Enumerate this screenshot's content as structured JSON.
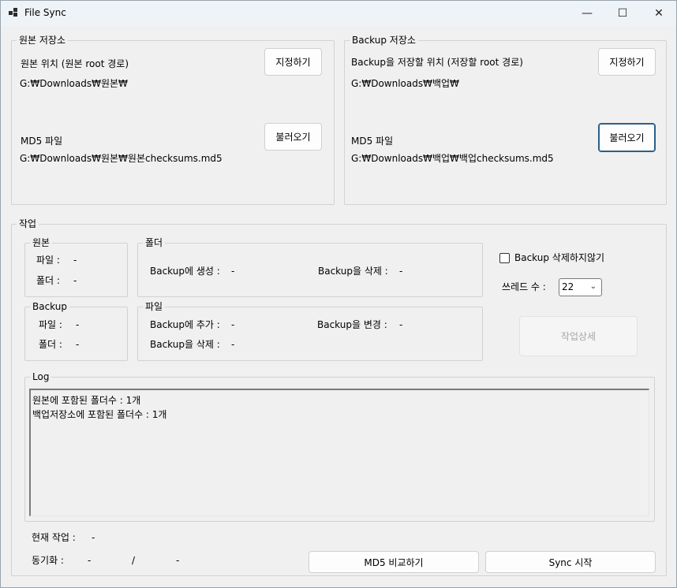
{
  "window": {
    "title": "File Sync",
    "minimize": "—",
    "maximize": "☐",
    "close": "✕"
  },
  "source": {
    "group_title": "원본 저장소",
    "location_label": "원본 위치 (원본 root 경로)",
    "location_button": "지정하기",
    "location_path": "G:₩Downloads₩원본₩",
    "md5_label": "MD5 파일",
    "md5_button": "불러오기",
    "md5_path": "G:₩Downloads₩원본₩원본checksums.md5"
  },
  "backup": {
    "group_title": "Backup 저장소",
    "location_label": "Backup을 저장할 위치 (저장할 root 경로)",
    "location_button": "지정하기",
    "location_path": "G:₩Downloads₩백업₩",
    "md5_label": "MD5 파일",
    "md5_button": "불러오기",
    "md5_path": "G:₩Downloads₩백업₩백업checksums.md5"
  },
  "work": {
    "group_title": "작업",
    "source_box": {
      "title": "원본",
      "file_label": "파일 :",
      "file_value": "-",
      "folder_label": "폴더 :",
      "folder_value": "-"
    },
    "backup_box": {
      "title": "Backup",
      "file_label": "파일 :",
      "file_value": "-",
      "folder_label": "폴더 :",
      "folder_value": "-"
    },
    "folder_box": {
      "title": "폴더",
      "create_label": "Backup에 생성 :",
      "create_value": "-",
      "delete_label": "Backup을 삭제 :",
      "delete_value": "-"
    },
    "file_box": {
      "title": "파일",
      "add_label": "Backup에 추가 :",
      "add_value": "-",
      "change_label": "Backup을 변경 :",
      "change_value": "-",
      "delete_label": "Backup을 삭제 :",
      "delete_value": "-"
    },
    "no_delete_label": "Backup 삭제하지않기",
    "no_delete_checked": false,
    "thread_label": "쓰레드 수 :",
    "thread_value": "22",
    "detail_button": "작업상세",
    "log_title": "Log",
    "log_lines": [
      "원본에 포함된 폴더수 : 1개",
      "백업저장소에 포함된 폴더수 : 1개"
    ],
    "current_label": "현재 작업 :",
    "current_value": "-",
    "sync_label": "동기화 :",
    "sync_done": "-",
    "sync_sep": "/",
    "sync_total": "-",
    "md5_compare_button": "MD5 비교하기",
    "sync_start_button": "Sync 시작"
  }
}
